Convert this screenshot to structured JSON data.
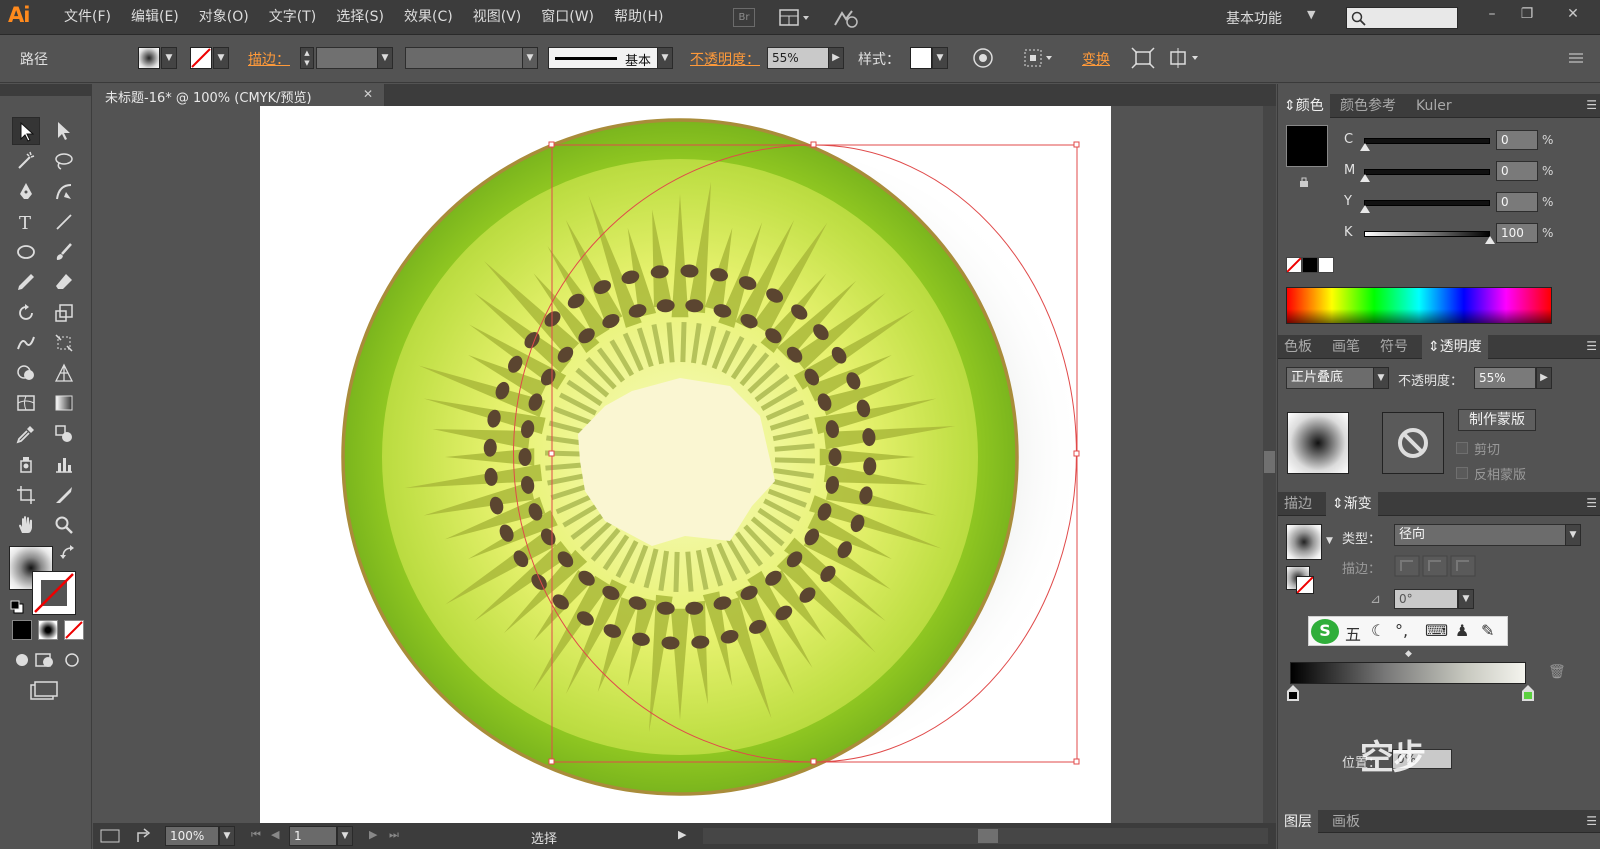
{
  "app": {
    "logo": "Ai",
    "menu": [
      "文件(F)",
      "编辑(E)",
      "对象(O)",
      "文字(T)",
      "选择(S)",
      "效果(C)",
      "视图(V)",
      "窗口(W)",
      "帮助(H)"
    ],
    "bridge_badge": "Br",
    "workspace": "基本功能"
  },
  "control_bar": {
    "selection_type": "路径",
    "stroke_label": "描边：",
    "stroke_profile": "基本",
    "opacity_label": "不透明度：",
    "opacity_value": "55%",
    "style_label": "样式：",
    "transform_label": "变换"
  },
  "document": {
    "tab_title": "未标题-16* @ 100% (CMYK/预览)",
    "zoom": "100%",
    "artboard_number": "1",
    "status": "选择"
  },
  "color_panel": {
    "tabs": [
      "颜色",
      "颜色参考",
      "Kuler"
    ],
    "channels": [
      {
        "label": "C",
        "value": "0",
        "fraction": 0.0
      },
      {
        "label": "M",
        "value": "0",
        "fraction": 0.0
      },
      {
        "label": "Y",
        "value": "0",
        "fraction": 0.0
      },
      {
        "label": "K",
        "value": "100",
        "fraction": 1.0
      }
    ],
    "percent_sign": "%"
  },
  "transparency_panel": {
    "tabs": [
      "色板",
      "画笔",
      "符号",
      "透明度"
    ],
    "blend_mode": "正片叠底",
    "opacity_label": "不透明度：",
    "opacity_value": "55%",
    "make_mask_button": "制作蒙版",
    "clip_label": "剪切",
    "invert_mask_label": "反相蒙版"
  },
  "gradient_panel": {
    "tabs": [
      "描边",
      "渐变"
    ],
    "type_label": "类型：",
    "type_value": "径向",
    "stroke_label": "描边：",
    "angle_value": "0°",
    "location_label": "位置：",
    "location_value": "0%"
  },
  "bottom_tabs": [
    "图层",
    "画板"
  ],
  "ime": {
    "mode": "五"
  },
  "watermark": "空步"
}
